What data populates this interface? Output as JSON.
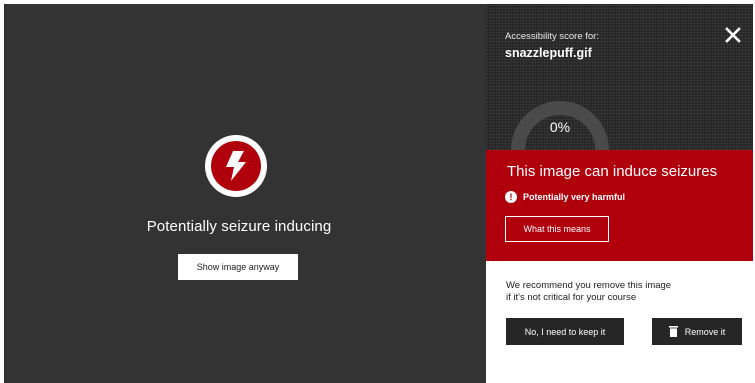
{
  "preview": {
    "title": "Potentially seizure inducing",
    "show_button": "Show image anyway",
    "icon": "lightning-bolt-icon"
  },
  "panel": {
    "score_label": "Accessibility score for:",
    "file_name": "snazzlepuff.gif",
    "score_value": "0%",
    "score_fraction": 0,
    "close_icon": "close-icon",
    "warning": {
      "title": "This image can induce seizures",
      "severity": "Potentially very harmful",
      "severity_icon": "exclamation-icon",
      "what_button": "What this means"
    },
    "recommendation": {
      "line1": "We recommend you remove this image",
      "line2": "if it's not critical for your course"
    },
    "keep_button": "No, I need to keep it",
    "remove_button": "Remove it",
    "remove_icon": "trash-icon"
  },
  "colors": {
    "alert_red": "#b0000c",
    "dark": "#262626",
    "preview_bg": "#333333"
  }
}
